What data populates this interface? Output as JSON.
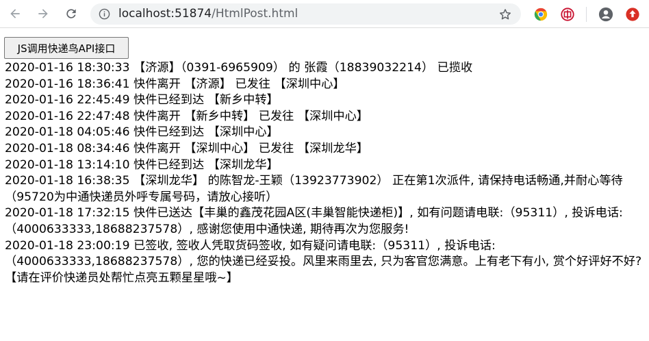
{
  "browser": {
    "url_host": "localhost:51874",
    "url_path": "/HtmlPost.html",
    "icons": [
      "back-arrow-icon",
      "forward-arrow-icon",
      "reload-icon",
      "info-icon",
      "star-icon",
      "chrome-extension-icon",
      "bank-extension-icon",
      "profile-icon",
      "update-icon"
    ]
  },
  "page": {
    "button_label": "JS调用快递鸟API接口",
    "lines": [
      "2020-01-16 18:30:33 【济源】（0391-6965909） 的 张霞（18839032214） 已揽收",
      "2020-01-16 18:36:41 快件离开 【济源】 已发往 【深圳中心】",
      "2020-01-16 22:45:49 快件已经到达 【新乡中转】",
      "2020-01-16 22:47:48 快件离开 【新乡中转】 已发往 【深圳中心】",
      "2020-01-18 04:05:46 快件已经到达 【深圳中心】",
      "2020-01-18 08:34:46 快件离开 【深圳中心】 已发往 【深圳龙华】",
      "2020-01-18 13:14:10 快件已经到达 【深圳龙华】",
      "2020-01-18 16:38:35 【深圳龙华】 的陈智龙-王颖（13923773902） 正在第1次派件, 请保持电话畅通,并耐心等待（95720为中通快递员外呼专属号码，请放心接听）",
      "2020-01-18 17:32:15 快件已送达【丰巢的鑫茂花园A区(丰巢智能快递柜)】, 如有问题请电联:（95311）, 投诉电话:（4000633333,18688237578）, 感谢您使用中通快递, 期待再次为您服务!",
      "2020-01-18 23:00:19 已签收, 签收人凭取货码签收, 如有疑问请电联:（95311）, 投诉电话:（4000633333,18688237578）, 您的快递已经妥投。风里来雨里去, 只为客官您满意。上有老下有小, 赏个好评好不好? 【请在评价快递员处帮忙点亮五颗星星哦~】"
    ]
  }
}
